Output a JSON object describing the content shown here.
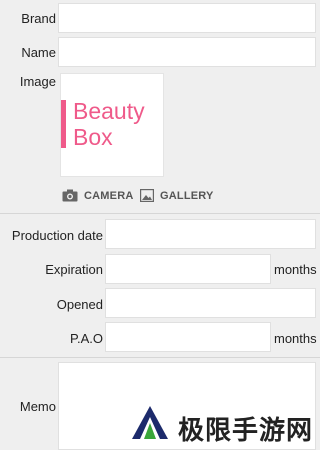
{
  "form": {
    "brand_label": "Brand",
    "brand_value": "",
    "name_label": "Name",
    "name_value": "",
    "image_label": "Image",
    "image_text": "Beauty Box",
    "camera_label": "CAMERA",
    "gallery_label": "GALLERY",
    "production_label": "Production date",
    "production_value": "",
    "expiration_label": "Expiration",
    "expiration_value": "",
    "expiration_unit": "months",
    "opened_label": "Opened",
    "opened_value": "",
    "pao_label": "P.A.O",
    "pao_value": "",
    "pao_unit": "months",
    "memo_label": "Memo",
    "memo_value": ""
  },
  "watermark": {
    "text": "极限手游网",
    "icon": "triangle-logo-icon"
  },
  "colors": {
    "accent_pink": "#ef5a8a",
    "background": "#efefef",
    "field": "#ffffff"
  }
}
